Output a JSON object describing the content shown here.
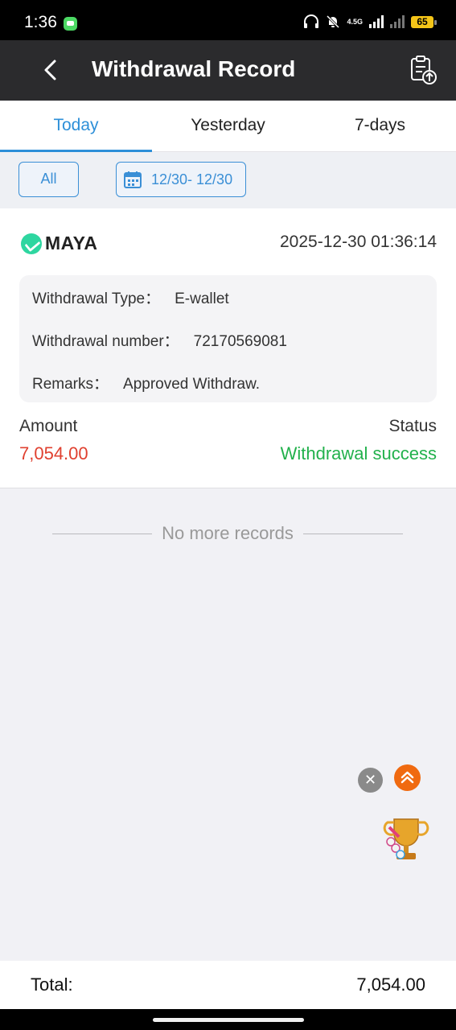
{
  "status_bar": {
    "time": "1:36",
    "network": "4.5G",
    "battery": "65"
  },
  "header": {
    "title": "Withdrawal Record"
  },
  "tabs": [
    {
      "label": "Today",
      "active": true
    },
    {
      "label": "Yesterday",
      "active": false
    },
    {
      "label": "7-days",
      "active": false
    }
  ],
  "filters": {
    "all_label": "All",
    "date_range": "12/30- 12/30"
  },
  "record": {
    "provider": "MAYA",
    "datetime": "2025-12-30 01:36:14",
    "type_label": "Withdrawal Type：",
    "type_value": "E-wallet",
    "number_label": "Withdrawal number：",
    "number_value": "72170569081",
    "remarks_label": "Remarks：",
    "remarks_value": "Approved Withdraw.",
    "amount_label": "Amount",
    "amount_value": "7,054.00",
    "status_label": "Status",
    "status_value": "Withdrawal success"
  },
  "footer_note": "No more records",
  "total": {
    "label": "Total:",
    "value": "7,054.00"
  },
  "colors": {
    "accent": "#2d8fd8",
    "amount": "#e0402f",
    "success": "#22b14c",
    "header_bg": "#2b2b2d",
    "fab_orange": "#f06a10"
  },
  "icons": [
    "chat-icon",
    "headphones-icon",
    "bell-off-icon",
    "signal-icon",
    "battery-icon",
    "back-arrow-icon",
    "upload-document-icon",
    "calendar-icon",
    "maya-logo-icon",
    "close-icon",
    "scroll-top-icon",
    "trophy-icon"
  ]
}
